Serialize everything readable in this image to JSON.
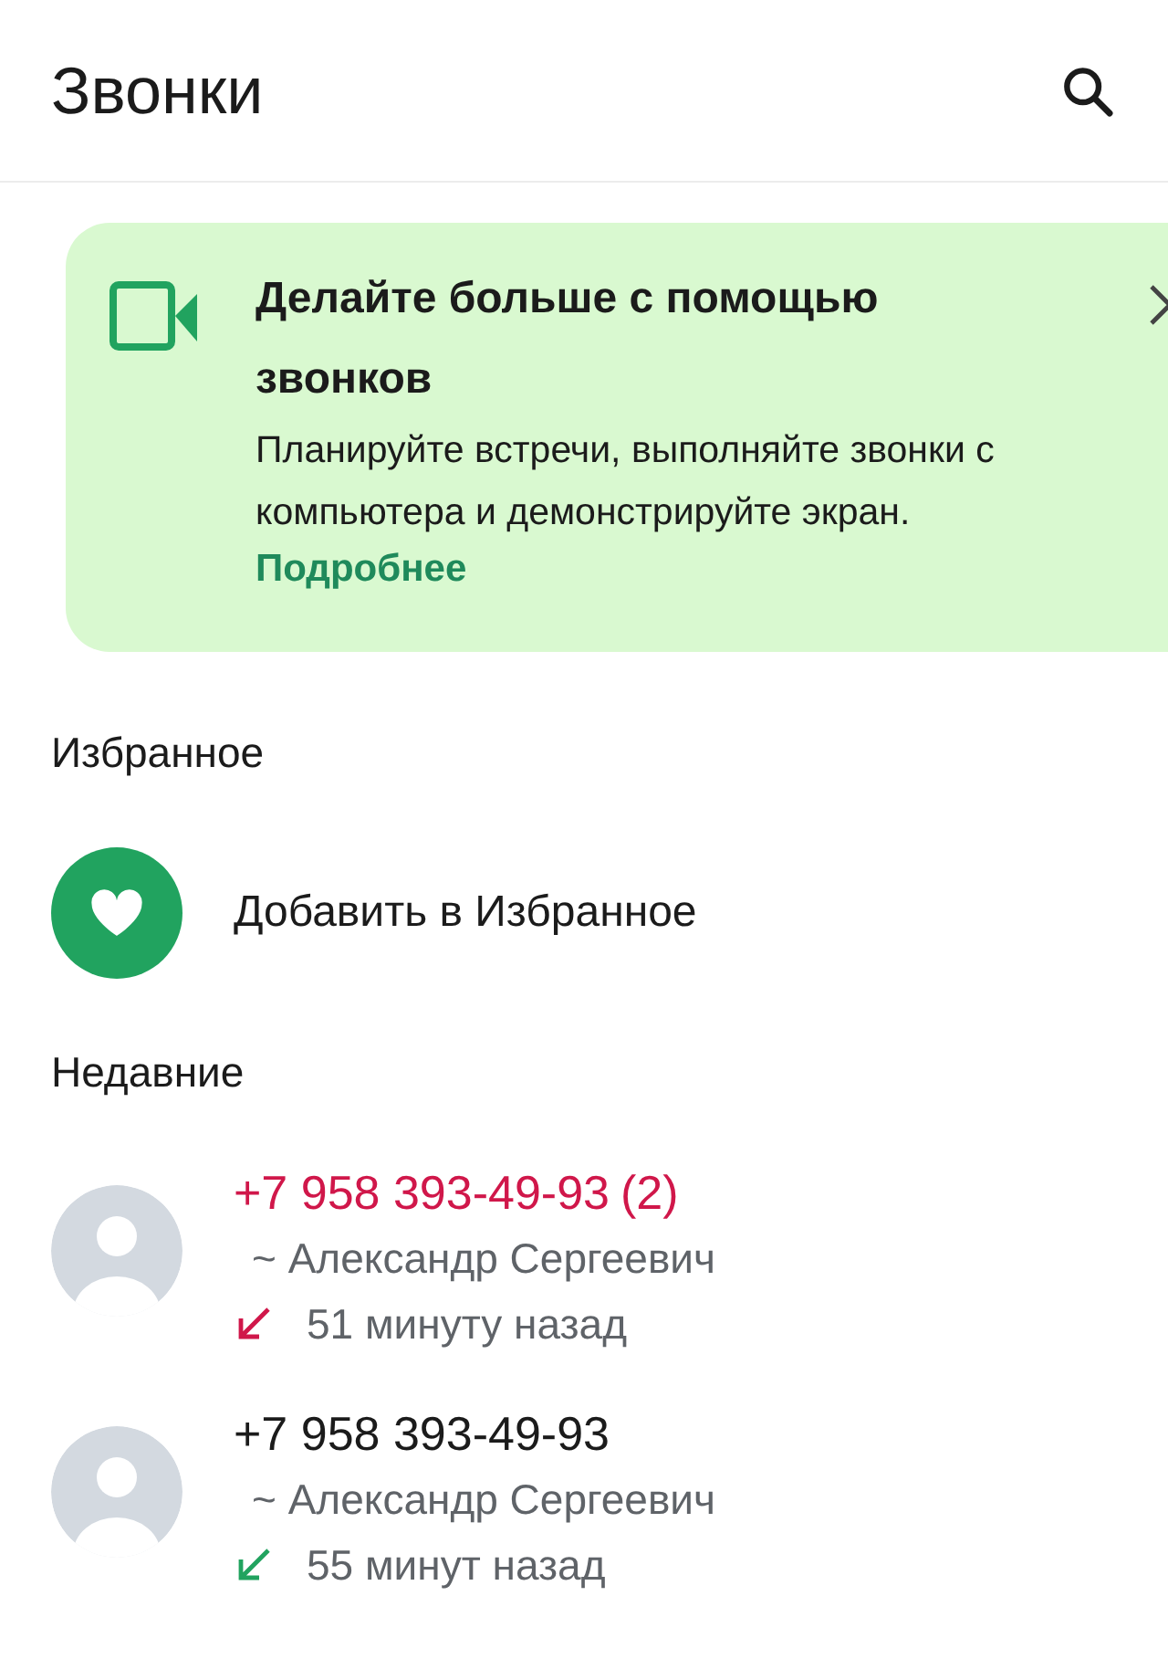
{
  "header": {
    "title": "Звонки"
  },
  "promo": {
    "title": "Делайте больше с помощью звонков",
    "text": "Планируйте встречи, выполняйте звонки с компьютера и демонстрируйте экран.",
    "link": "Подробнее"
  },
  "favorites": {
    "heading": "Избранное",
    "add_label": "Добавить в Избранное"
  },
  "recent": {
    "heading": "Недавние",
    "calls": [
      {
        "number": "+7 958 393-49-93",
        "count": "(2)",
        "name": "~ Александр Сергеевич",
        "time": "51 минуту назад",
        "kind": "missed"
      },
      {
        "number": "+7 958 393-49-93",
        "name": "~ Александр Сергеевич",
        "time": "55 минут назад",
        "kind": "incoming"
      }
    ]
  }
}
